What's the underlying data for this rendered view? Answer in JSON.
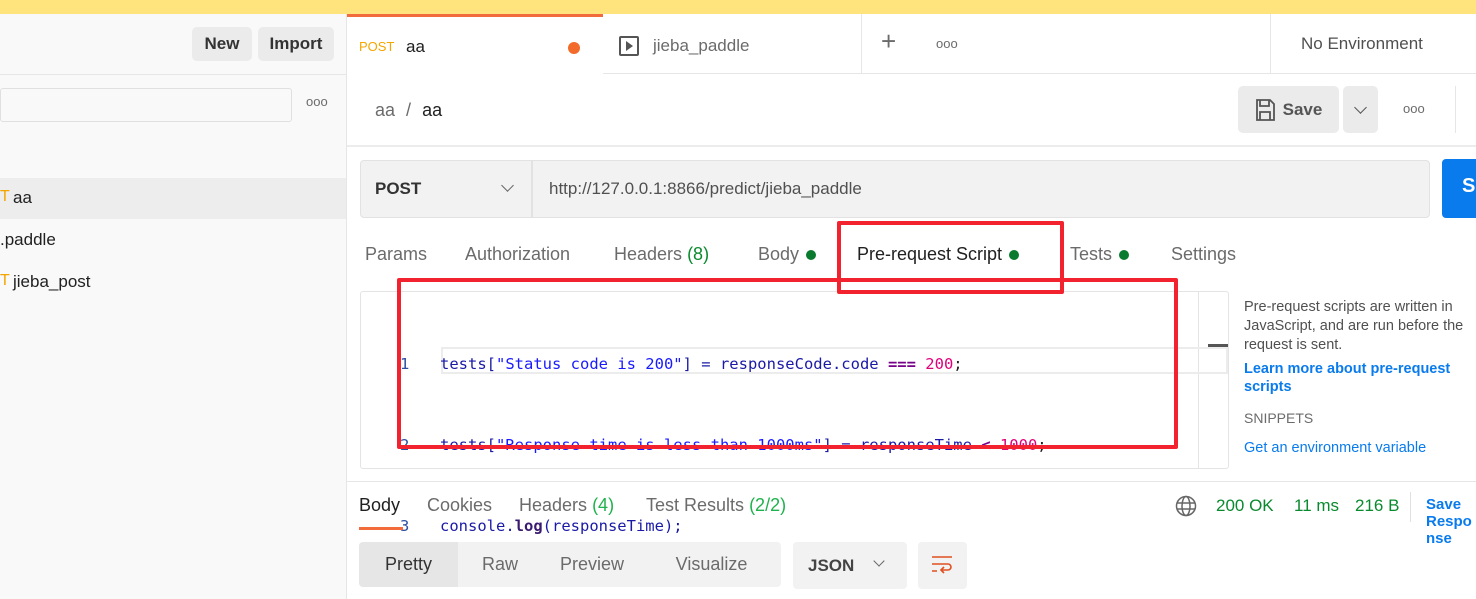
{
  "sidebar": {
    "new_label": "New",
    "import_label": "Import",
    "more": "ooo",
    "items": [
      {
        "method": "T",
        "name": "aa",
        "selected": true
      },
      {
        "method": "",
        "name": ".paddle"
      },
      {
        "method": "T",
        "name": "jieba_post"
      }
    ]
  },
  "tabs": [
    {
      "method": "POST",
      "name": "aa",
      "unsaved": true
    },
    {
      "name": "jieba_paddle",
      "icon": "play-icon"
    }
  ],
  "tabbar": {
    "add": "+",
    "more": "ooo",
    "environment": "No Environment"
  },
  "breadcrumb": {
    "parent": "aa",
    "sep": "/",
    "current": "aa"
  },
  "toolbar": {
    "save_label": "Save",
    "more": "ooo"
  },
  "request": {
    "method": "POST",
    "url": "http://127.0.0.1:8866/predict/jieba_paddle",
    "send_label": "S"
  },
  "req_tabs": {
    "params": "Params",
    "authorization": "Authorization",
    "headers": "Headers",
    "headers_count": "(8)",
    "body": "Body",
    "prerequest": "Pre-request Script",
    "tests": "Tests",
    "settings": "Settings"
  },
  "editor": {
    "lines": [
      {
        "num": "1",
        "t1": "tests[",
        "s": "\"Status code is 200\"",
        "t2": "] = responseCode.code ",
        "op": "===",
        "sp": " ",
        "n": "200",
        "end": ";"
      },
      {
        "num": "2",
        "t1": "tests[",
        "s": "\"Response time is less than 1000ms\"",
        "t2": "] = responseTime ",
        "op": "<",
        "sp": " ",
        "n": "1000",
        "end": ";"
      },
      {
        "num": "3",
        "a": "console.",
        "b": "log",
        "c": "(responseTime);"
      }
    ]
  },
  "help": {
    "text": "Pre-request scripts are written in JavaScript, and are run before the request is sent.",
    "link": "Learn more about pre-request scripts",
    "snippets": "SNIPPETS",
    "snippet1": "Get an environment variable"
  },
  "response": {
    "tabs": {
      "body": "Body",
      "cookies": "Cookies",
      "headers": "Headers",
      "headers_count": "(4)",
      "tests": "Test Results",
      "tests_count": "(2/2)"
    },
    "status": "200 OK",
    "time": "11 ms",
    "size": "216 B",
    "save": "Save Response"
  },
  "view": {
    "modes": [
      "Pretty",
      "Raw",
      "Preview",
      "Visualize"
    ],
    "format": "JSON"
  },
  "colors": {
    "accent": "#ff6c37",
    "send": "#097bed",
    "highlight": "#f3222f"
  }
}
